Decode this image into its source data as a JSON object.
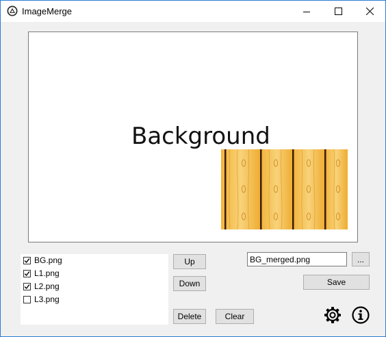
{
  "window": {
    "title": "ImageMerge"
  },
  "preview": {
    "text": "Background"
  },
  "layers": [
    {
      "name": "BG.png",
      "checked": true
    },
    {
      "name": "L1.png",
      "checked": true
    },
    {
      "name": "L2.png",
      "checked": true
    },
    {
      "name": "L3.png",
      "checked": false
    }
  ],
  "buttons": {
    "up": "Up",
    "down": "Down",
    "delete": "Delete",
    "clear": "Clear",
    "save": "Save",
    "browse": "..."
  },
  "output": {
    "filename": "BG_merged.png"
  },
  "icons": {
    "settings": "gear-icon",
    "info": "info-icon"
  }
}
